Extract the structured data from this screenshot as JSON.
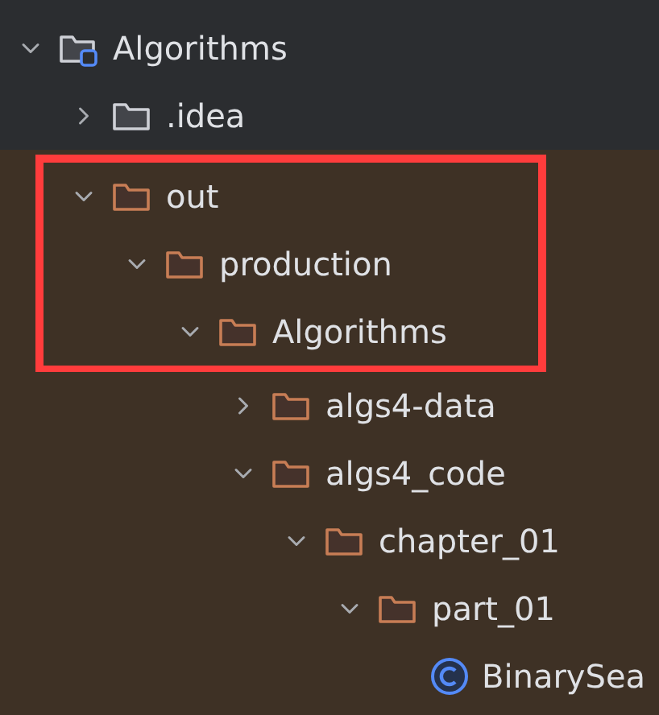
{
  "tree": [
    {
      "name": "Algorithms",
      "kind": "module",
      "expanded": true,
      "excluded": false,
      "framed": false,
      "children": [
        {
          "name": ".idea",
          "kind": "folder",
          "expanded": false,
          "excluded": false,
          "framed": false
        },
        {
          "name": "out",
          "kind": "folder",
          "expanded": true,
          "excluded": true,
          "framed": true,
          "children": [
            {
              "name": "production",
              "kind": "folder",
              "expanded": true,
              "excluded": true,
              "framed": true,
              "children": [
                {
                  "name": "Algorithms",
                  "kind": "folder",
                  "expanded": true,
                  "excluded": true,
                  "framed": true,
                  "children": [
                    {
                      "name": "algs4-data",
                      "kind": "folder",
                      "expanded": false,
                      "excluded": true,
                      "framed": false
                    },
                    {
                      "name": "algs4_code",
                      "kind": "folder",
                      "expanded": true,
                      "excluded": true,
                      "framed": false,
                      "children": [
                        {
                          "name": "chapter_01",
                          "kind": "folder",
                          "expanded": true,
                          "excluded": true,
                          "framed": false,
                          "children": [
                            {
                              "name": "part_01",
                              "kind": "folder",
                              "expanded": true,
                              "excluded": true,
                              "framed": false,
                              "children": [
                                {
                                  "name": "BinarySea",
                                  "kind": "class",
                                  "excluded": true,
                                  "framed": false
                                }
                              ]
                            }
                          ]
                        }
                      ]
                    }
                  ]
                }
              ]
            }
          ]
        }
      ]
    }
  ]
}
